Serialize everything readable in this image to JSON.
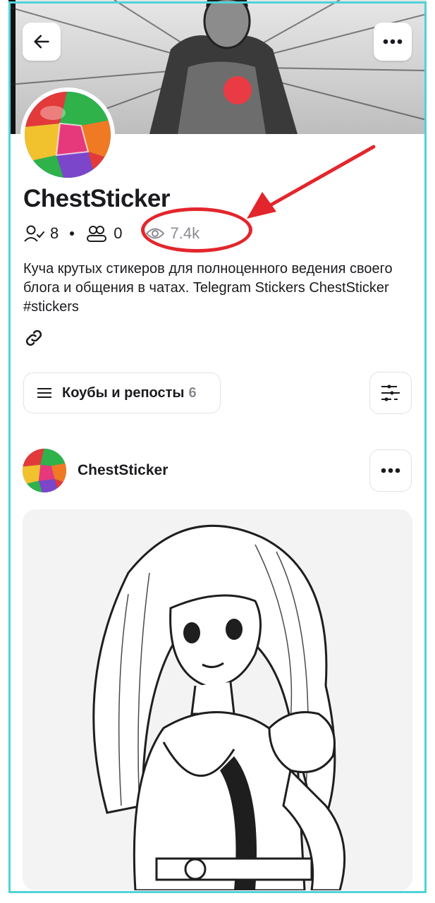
{
  "profile": {
    "name": "ChestSticker",
    "followers": "8",
    "following": "0",
    "views": "7.4k",
    "description": "Куча крутых стикеров для полноценного ведения своего блога и общения в чатах. Telegram Stickers ChestSticker #stickers"
  },
  "filter": {
    "label": "Коубы и репосты",
    "count": "6"
  },
  "post": {
    "author": "ChestSticker"
  },
  "icons": {
    "back": "arrow-left-icon",
    "more": "more-dots-icon",
    "followers": "user-check-icon",
    "following": "users-icon",
    "views": "eye-icon",
    "link": "link-icon",
    "menu": "hamburger-icon",
    "settings": "sliders-icon"
  },
  "colors": {
    "annotation": "#e3262c",
    "frame": "#4fd3d8",
    "muted": "#8a8a93"
  }
}
